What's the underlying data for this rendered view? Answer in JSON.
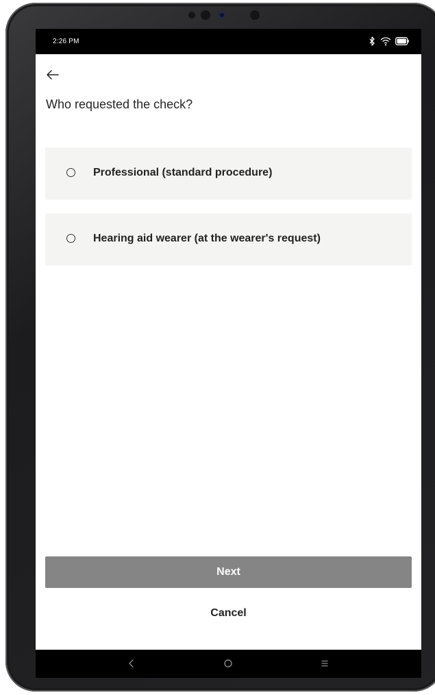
{
  "status_bar": {
    "time": "2:26 PM",
    "icons": [
      "bluetooth-icon",
      "wifi-icon",
      "battery-icon"
    ]
  },
  "header": {
    "back_icon": "arrow-left-icon",
    "title": "Who requested the check?"
  },
  "options": [
    {
      "label": "Professional (standard procedure)",
      "selected": false
    },
    {
      "label": "Hearing aid wearer (at the wearer's request)",
      "selected": false
    }
  ],
  "actions": {
    "next_label": "Next",
    "cancel_label": "Cancel"
  },
  "nav_bar": {
    "icons": [
      "back-chevron-icon",
      "home-circle-icon",
      "menu-lines-icon"
    ]
  },
  "colors": {
    "option_bg": "#f4f4f3",
    "next_bg": "#858585",
    "text": "#222222"
  }
}
